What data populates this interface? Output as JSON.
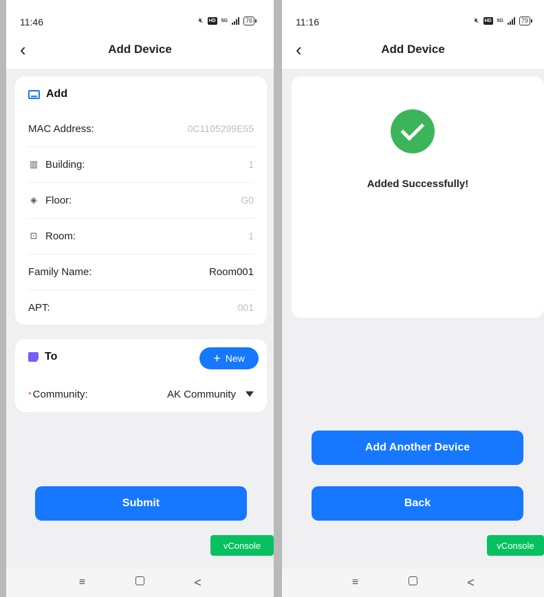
{
  "left_screen": {
    "status": {
      "time": "11:46",
      "network": "5G",
      "battery": "76"
    },
    "title": "Add Device",
    "add_card": {
      "header": "Add",
      "rows": [
        {
          "label": "MAC Address:",
          "value": "0C1105299E55"
        },
        {
          "label": "Building:",
          "value": "1"
        },
        {
          "label": "Floor:",
          "value": "G0"
        },
        {
          "label": "Room:",
          "value": "1"
        },
        {
          "label": "Family Name:",
          "value": "Room001"
        },
        {
          "label": "APT:",
          "value": "001"
        }
      ]
    },
    "to_card": {
      "header": "To",
      "new_button": "New",
      "required_mark": "*",
      "community_label": "Community:",
      "community_value": "AK Community"
    },
    "submit_label": "Submit",
    "vconsole_label": "vConsole"
  },
  "right_screen": {
    "status": {
      "time": "11:16",
      "network": "5G",
      "battery": "79"
    },
    "title": "Add Device",
    "success_text": "Added Successfully!",
    "add_another_label": "Add Another Device",
    "back_label": "Back",
    "vconsole_label": "vConsole"
  },
  "system_nav": {
    "menu_glyph": "≡",
    "back_glyph": "<"
  },
  "colors": {
    "primary": "#1677ff",
    "success": "#3cb55a",
    "vconsole": "#07c160",
    "required": "#e53935"
  }
}
